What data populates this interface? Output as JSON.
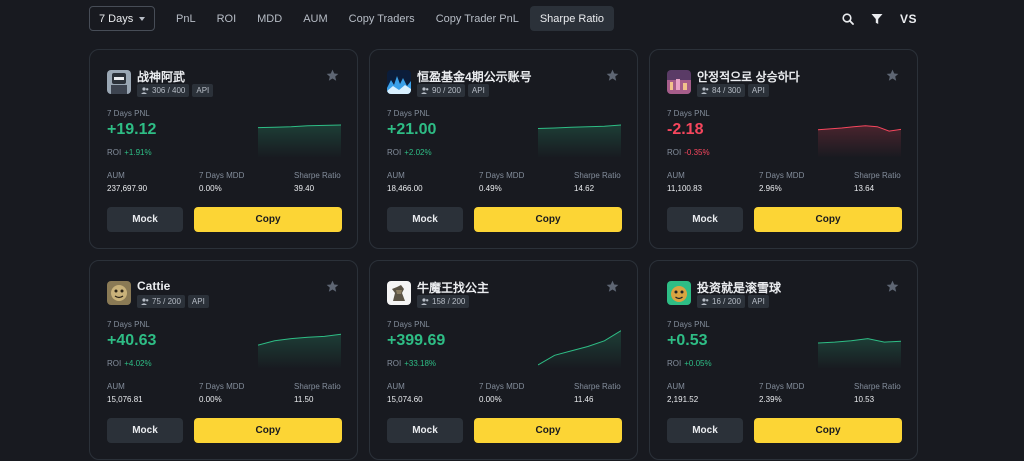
{
  "toolbar": {
    "period": "7 Days",
    "tabs": [
      "PnL",
      "ROI",
      "MDD",
      "AUM",
      "Copy Traders",
      "Copy Trader PnL",
      "Sharpe Ratio"
    ],
    "active_tab": "Sharpe Ratio",
    "vs_label": "VS"
  },
  "labels": {
    "pnl": "7 Days PNL",
    "roi": "ROI",
    "aum": "AUM",
    "mdd": "7 Days MDD",
    "sharpe": "Sharpe Ratio",
    "mock": "Mock",
    "copy": "Copy",
    "api": "API"
  },
  "colors": {
    "up": "#2ebd85",
    "down": "#f6465d",
    "accent": "#fcd535"
  },
  "traders": [
    {
      "name": "战神阿武",
      "copiers": "306 / 400",
      "api": true,
      "pnl": "+19.12",
      "roi": "+1.91%",
      "direction": "up",
      "aum": "237,697.90",
      "mdd": "0.00%",
      "sharpe": "39.40",
      "spark": [
        0.6,
        0.61,
        0.62,
        0.64,
        0.65,
        0.66
      ]
    },
    {
      "name": "恒盈基金4期公示账号",
      "copiers": "90 / 200",
      "api": true,
      "pnl": "+21.00",
      "roi": "+2.02%",
      "direction": "up",
      "aum": "18,466.00",
      "mdd": "0.49%",
      "sharpe": "14.62",
      "spark": [
        0.58,
        0.59,
        0.61,
        0.62,
        0.63,
        0.66
      ]
    },
    {
      "name": "안정적으로 상승하다",
      "copiers": "84 / 300",
      "api": true,
      "pnl": "-2.18",
      "roi": "-0.35%",
      "direction": "down",
      "aum": "11,100.83",
      "mdd": "2.96%",
      "sharpe": "13.64",
      "spark": [
        0.55,
        0.57,
        0.59,
        0.62,
        0.64,
        0.62,
        0.52,
        0.56
      ]
    },
    {
      "name": "Cattie",
      "copiers": "75 / 200",
      "api": true,
      "pnl": "+40.63",
      "roi": "+4.02%",
      "direction": "up",
      "aum": "15,076.81",
      "mdd": "0.00%",
      "sharpe": "11.50",
      "spark": [
        0.45,
        0.55,
        0.6,
        0.63,
        0.65,
        0.7
      ]
    },
    {
      "name": "牛魔王找公主",
      "copiers": "158 / 200",
      "api": false,
      "pnl": "+399.69",
      "roi": "+33.18%",
      "direction": "up",
      "aum": "15,074.60",
      "mdd": "0.00%",
      "sharpe": "11.46",
      "spark": [
        0.0,
        0.22,
        0.32,
        0.42,
        0.55,
        0.78
      ]
    },
    {
      "name": "投资就是滚雪球",
      "copiers": "16 / 200",
      "api": true,
      "pnl": "+0.53",
      "roi": "+0.05%",
      "direction": "up",
      "aum": "2,191.52",
      "mdd": "2.39%",
      "sharpe": "10.53",
      "spark": [
        0.5,
        0.52,
        0.55,
        0.6,
        0.52,
        0.54
      ]
    }
  ]
}
